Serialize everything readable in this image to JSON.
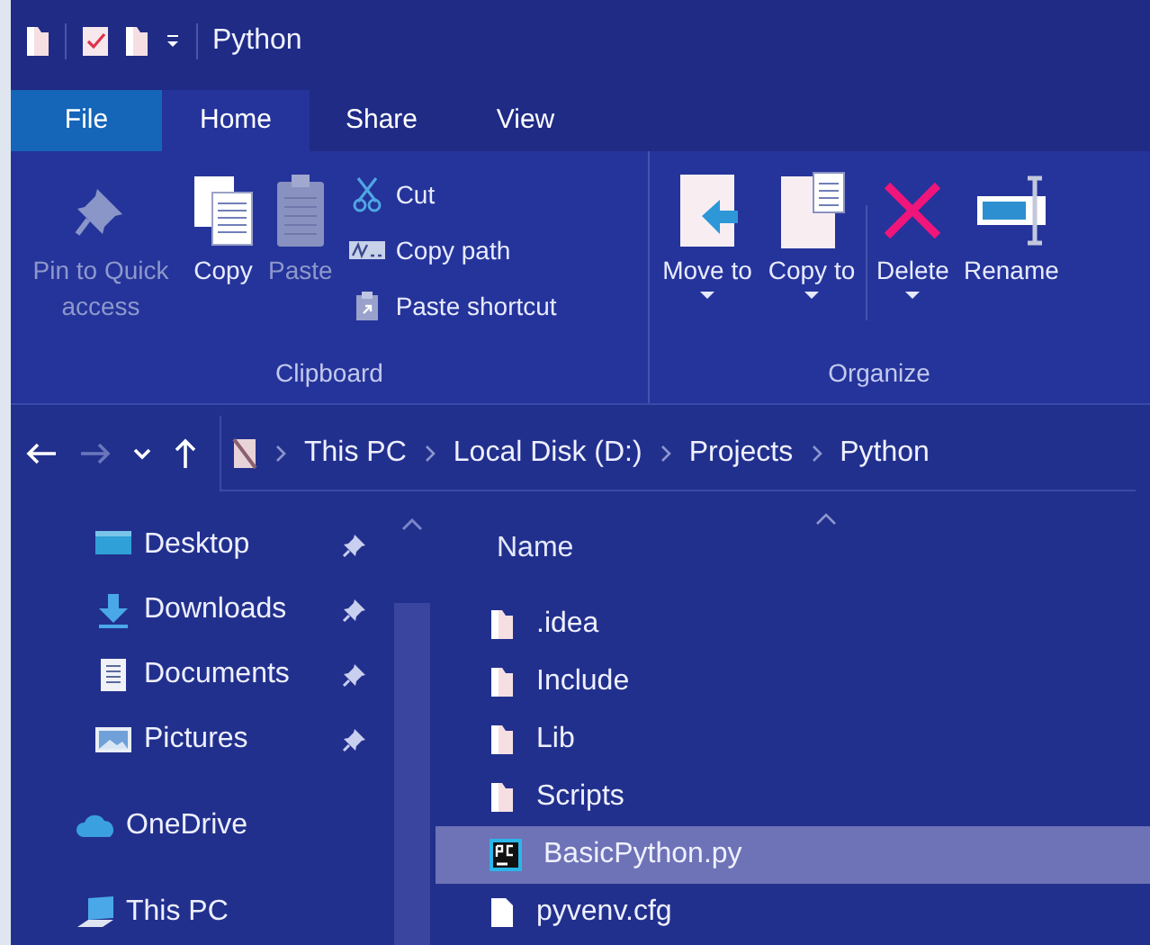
{
  "window": {
    "title": "Python"
  },
  "file_tab": {
    "label": "File"
  },
  "tabs": [
    {
      "label": "Home",
      "selected": true
    },
    {
      "label": "Share",
      "selected": false
    },
    {
      "label": "View",
      "selected": false
    }
  ],
  "ribbon": {
    "groups": [
      {
        "title": "Clipboard",
        "large": [
          {
            "label": "Pin to Quick access",
            "kind": "pin",
            "disabled": true,
            "dropdown": false
          },
          {
            "label": "Copy",
            "kind": "copy",
            "disabled": false,
            "dropdown": false
          },
          {
            "label": "Paste",
            "kind": "paste",
            "disabled": true,
            "dropdown": false
          }
        ],
        "small": [
          {
            "label": "Cut",
            "kind": "cut"
          },
          {
            "label": "Copy path",
            "kind": "path"
          },
          {
            "label": "Paste shortcut",
            "kind": "shortcut"
          }
        ]
      },
      {
        "title": "Organize",
        "large": [
          {
            "label": "Move to",
            "kind": "move",
            "disabled": false,
            "dropdown": true
          },
          {
            "label": "Copy to",
            "kind": "copyto",
            "disabled": false,
            "dropdown": true
          },
          {
            "label": "Delete",
            "kind": "delete",
            "disabled": false,
            "dropdown": true
          },
          {
            "label": "Rename",
            "kind": "rename",
            "disabled": false,
            "dropdown": false
          }
        ]
      }
    ]
  },
  "address": {
    "forward_disabled": true,
    "breadcrumbs": [
      "This PC",
      "Local Disk (D:)",
      "Projects",
      "Python"
    ]
  },
  "quick_access": [
    {
      "label": "Desktop",
      "kind": "desktop",
      "pinned": true
    },
    {
      "label": "Downloads",
      "kind": "download",
      "pinned": true
    },
    {
      "label": "Documents",
      "kind": "documents",
      "pinned": true
    },
    {
      "label": "Pictures",
      "kind": "pictures",
      "pinned": true
    }
  ],
  "locations": [
    {
      "label": "OneDrive",
      "kind": "cloud"
    },
    {
      "label": "This PC",
      "kind": "pc"
    }
  ],
  "columns": [
    {
      "label": "Name"
    }
  ],
  "files": [
    {
      "name": ".idea",
      "kind": "folder",
      "selected": false
    },
    {
      "name": "Include",
      "kind": "folder",
      "selected": false
    },
    {
      "name": "Lib",
      "kind": "folder",
      "selected": false
    },
    {
      "name": "Scripts",
      "kind": "folder",
      "selected": false
    },
    {
      "name": "BasicPython.py",
      "kind": "pycharm",
      "selected": true
    },
    {
      "name": "pyvenv.cfg",
      "kind": "file",
      "selected": false
    }
  ]
}
